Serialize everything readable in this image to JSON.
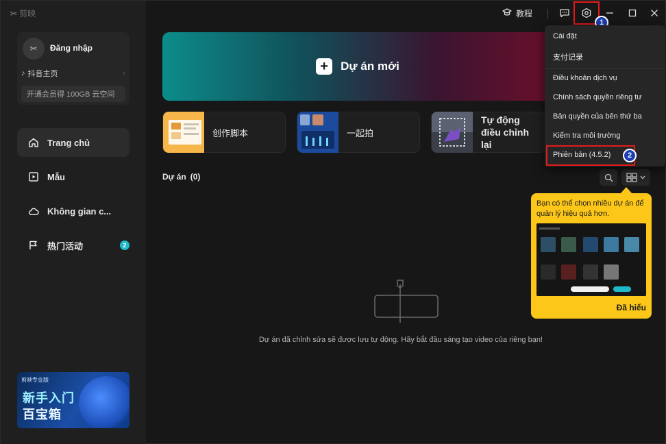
{
  "app": {
    "logo_text": "剪映"
  },
  "account": {
    "avatar_glyph": "✂",
    "login_label": "Đăng nhập",
    "douyin_label": "抖音主页",
    "vip_label": "开通会员得 100GB 云空间"
  },
  "nav": {
    "items": [
      {
        "label": "Trang chủ",
        "icon": "home-icon"
      },
      {
        "label": "Mẫu",
        "icon": "template-icon"
      },
      {
        "label": "Không gian c...",
        "icon": "cloud-icon"
      },
      {
        "label": "热门活动",
        "icon": "flag-icon",
        "badge": "2"
      }
    ]
  },
  "promo": {
    "brand": "剪映专业版",
    "line1": "新手入门",
    "line2": "百宝箱"
  },
  "titlebar": {
    "tutorial_label": "教程"
  },
  "hero": {
    "new_project_label": "Dự án mới"
  },
  "quick_actions": [
    {
      "label": "创作脚本"
    },
    {
      "label": "一起拍"
    },
    {
      "label": "Tự động điều chỉnh lại"
    }
  ],
  "projects": {
    "title": "Dự án",
    "count": "(0)",
    "empty_message": "Dự án đã chỉnh sửa sẽ được lưu tự động. Hãy bắt đầu sáng tạo video của riêng bạn!"
  },
  "menu": {
    "items": [
      "Cài đặt",
      "支付记录",
      "Điều khoản dịch vụ",
      "Chính sách quyền riêng tư",
      "Bản quyền của bên thứ ba",
      "Kiểm tra môi trường",
      "Phiên bản (4.5.2)"
    ]
  },
  "annotations": {
    "step1": "1",
    "step2": "2"
  },
  "tooltip": {
    "text": "Bạn có thể chọn nhiều dự án để quản lý hiệu quả hơn.",
    "ok_label": "Đã hiểu"
  },
  "colors": {
    "accent_teal": "#1fb9c9",
    "highlight_red": "#e31b1b",
    "step_blue": "#1c3fb5",
    "tooltip_yellow": "#fcc718"
  }
}
